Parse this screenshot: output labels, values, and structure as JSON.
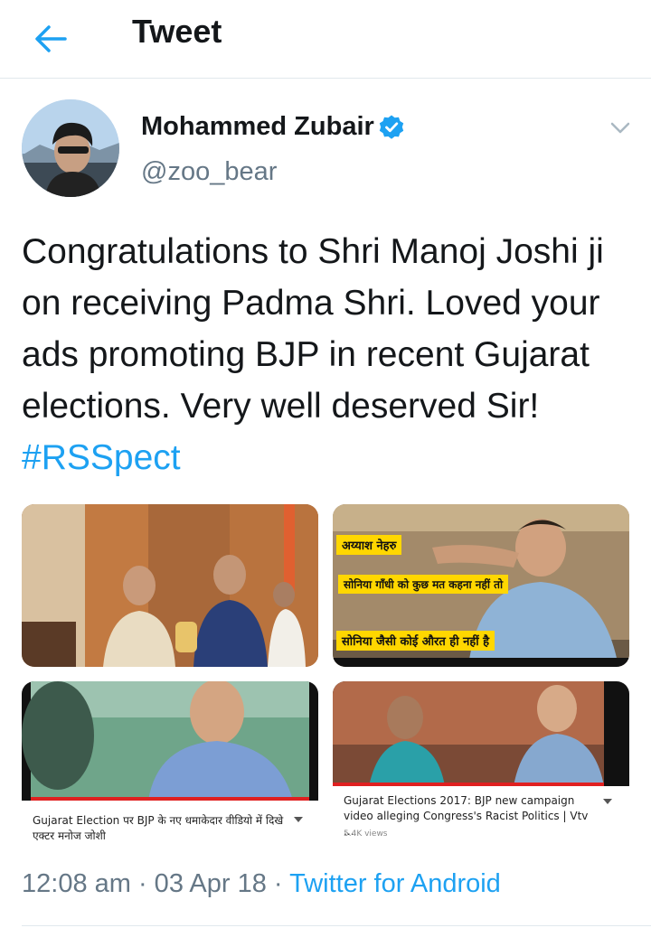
{
  "header": {
    "title": "Tweet"
  },
  "tweet": {
    "author": {
      "name": "Mohammed Zubair",
      "handle": "@zoo_bear",
      "verified": true
    },
    "text": "Congratulations to Shri Manoj Joshi ji on receiving Padma Shri. Loved your ads promoting BJP in recent Gujarat elections. Very well deserved Sir! ",
    "hashtag": "#RSSpect",
    "timestamp": "12:08 am · 03 Apr 18 · ",
    "source": "Twitter for Android"
  },
  "media": {
    "image2": {
      "label1": "अय्याश नेहरु",
      "label2": "सोनिया गाँधी को कुछ मत कहना नहीं तो",
      "label3": "सोनिया जैसी कोई औरत ही नहीं है"
    },
    "image3": {
      "caption": "Gujarat Election पर BJP के नए धमाकेदार वीडियो में दिखे एक्टर मनोज जोशी"
    },
    "image4": {
      "caption": "Gujarat Elections 2017: BJP new campaign video alleging Congress's Racist Politics | Vtv ...",
      "views": "5.4K views"
    }
  },
  "colors": {
    "accent": "#1da1f2",
    "secondary_text": "#657786",
    "verified": "#1da1f2"
  }
}
